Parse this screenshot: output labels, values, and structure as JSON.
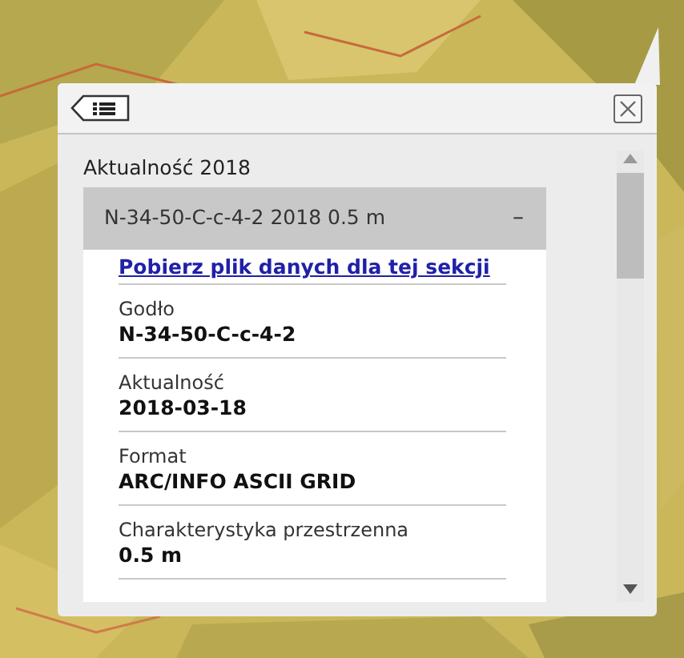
{
  "section_title": "Aktualność 2018",
  "accordion": {
    "title": "N-34-50-C-c-4-2 2018 0.5 m",
    "toggle_symbol": "–",
    "expanded": true
  },
  "link": "Pobierz plik danych dla tej sekcji",
  "fields": [
    {
      "label": "Godło",
      "value": "N-34-50-C-c-4-2"
    },
    {
      "label": "Aktualność",
      "value": "2018-03-18"
    },
    {
      "label": "Format",
      "value": "ARC/INFO ASCII GRID"
    },
    {
      "label": "Charakterystyka przestrzenna",
      "value": "0.5 m"
    }
  ]
}
